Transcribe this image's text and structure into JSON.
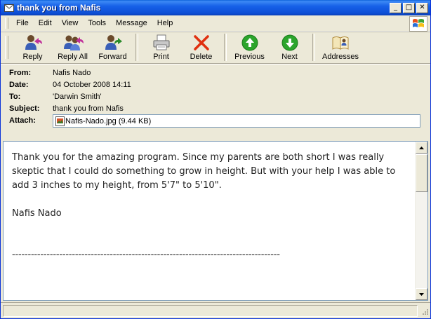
{
  "window": {
    "title": "thank you from Nafis",
    "controls": {
      "minimize": "_",
      "maximize": "□",
      "close": "✕"
    }
  },
  "menu": [
    "File",
    "Edit",
    "View",
    "Tools",
    "Message",
    "Help"
  ],
  "toolbar": {
    "reply": "Reply",
    "reply_all": "Reply All",
    "forward": "Forward",
    "print": "Print",
    "delete": "Delete",
    "previous": "Previous",
    "next": "Next",
    "addresses": "Addresses"
  },
  "headers": {
    "from_label": "From:",
    "from_value": "Nafis Nado",
    "date_label": "Date:",
    "date_value": "04 October 2008 14:11",
    "to_label": "To:",
    "to_value": "'Darwin Smith'",
    "subject_label": "Subject:",
    "subject_value": "thank you from Nafis",
    "attach_label": "Attach:",
    "attachment": "Nafis-Nado.jpg (9.44 KB)"
  },
  "message": {
    "paragraph": "Thank you for the amazing program. Since my parents are both short I was really skeptic that I could do something to grow in height. But with your help I was able to add 3 inches to my height, from 5'7\" to 5'10\".",
    "signature": "Nafis Nado",
    "rule": "-------------------------------------------------------------------------------------"
  },
  "colors": {
    "titlebar": "#0a5fd8",
    "chrome": "#ece9d8",
    "reply_arrow": "#c0309a",
    "forward_arrow": "#2a8a2a",
    "delete_x": "#e03010",
    "nav_green": "#2ca52c"
  }
}
